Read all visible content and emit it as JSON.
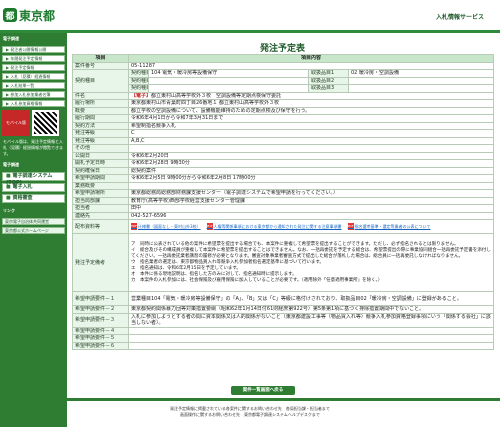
{
  "header": {
    "logo_text": "東京都",
    "logo_mark": "都",
    "service_name": "入札情報サービス"
  },
  "sidebar": {
    "section1": "電子調達",
    "nav": [
      "発注者公開情報公開",
      "年間発注予定情報",
      "発注予定情報",
      "入札（見積）経過情報",
      "入札結果一覧",
      "参加入札参加業者名簿",
      "入札参加資格情報"
    ],
    "mobile_label": "モバイル版",
    "mobile_note": "モバイル版は、発注予定情報と入札（見積）経過情報が閲覧できます。",
    "section2": "電子調達",
    "big": [
      "電子調達システム(TOP)",
      "電子入札",
      "資格審査"
    ],
    "section3": "リンク",
    "links": [
      "東京電子自治体共同運営",
      "東京都公式ホームページ"
    ]
  },
  "page": {
    "title": "発注予定表",
    "back_button": "案件一覧画面へ戻る"
  },
  "table": {
    "head_item": "項目",
    "head_content": "項目内容",
    "rows": [
      {
        "k": "案件番号",
        "v": "05-11287"
      },
      {
        "k": "契約種目1",
        "v": "104 電気・暖冷房等設備保守"
      },
      {
        "k": "取扱品目1",
        "v": "02 暖冷房・空調設備"
      },
      {
        "k": "件名",
        "tag": "【電子】",
        "v": "都立東村山高等学校外３校　空調設備等定期点検保守委託"
      },
      {
        "k": "履行場所",
        "v": "東京都東村山市青葉町四丁目26番地１ 都立東村山高等学校外３校"
      },
      {
        "k": "概要",
        "v": "都立学校の空調設備について、設備機能維持のための定期点検及び保守を行う。"
      },
      {
        "k": "履行期間",
        "v": "令和6年4月1日から令和7年3月31日まで"
      },
      {
        "k": "契約方法",
        "v": "希望制指名競争入札"
      },
      {
        "k": "発注等級",
        "v": "C"
      },
      {
        "k": "発注等級",
        "v": "A,B,C"
      },
      {
        "k": "その他",
        "v": ""
      },
      {
        "k": "公開日",
        "v": "令和6年2月20日"
      },
      {
        "k": "開札予定日時",
        "v": "令和6年2月28日 9時30分"
      },
      {
        "k": "契約確保日",
        "v": "総契約案件"
      },
      {
        "k": "希望申請期間",
        "v": "令和6年2月5日 9時00分から令和6年2月8日 17時00分"
      },
      {
        "k": "業務概要",
        "v": ""
      },
      {
        "k": "希望申請場所",
        "v": "東京都総務局総務部財務課支援センター（電子調達システムで希望申請を行ってください。）"
      },
      {
        "k": "担当局部課",
        "v": "教育庁(高等学校)西部学校経営支援センター管理課"
      },
      {
        "k": "担当者",
        "v": "田中"
      },
      {
        "k": "連絡先",
        "v": "042-527-6596"
      }
    ],
    "labels": {
      "kind": "契約種目",
      "item": "取扱品目",
      "docs": "配布資料等",
      "notes_head": "発注予定備考",
      "req": "希望申請要件"
    },
    "docs": [
      "仕様書（図面なし・東村山外3校）",
      "人権等関係事項における東京都から通知された発注に関する注意事項書",
      "指名選考基準・選定等業者の公表について"
    ],
    "notes": "ア　同時に公表されている他の案件に希望票を提出する場合でも、本案件に重複して希望票を提出することができます。ただし、必ず指名されるとは限りません。\nイ　総合及びその構成員が重複して本案件に希望票を提出することはできません。なお、一括再委託を予定する総合は、希望票提出の際に事業協同組合一括再委託予定書を添付してください。一括再委託業者講習の履修が必要となります。審査対象事業者審査方式で提出した総合が落札した場合は、総合員に一括再委託しなければなりません。\nウ　指名業者の選定は、東京都物品買入れ等競争入札参加者指名選定基準に基づいて行います。\nエ　指名通知は、令和6年2月15日を予定しています。\nオ　本件に係る現地説明は、指名した方のみに対して、指名通知時に提示します。\nカ　本案件の入札参加には、社会保険及び雇用保険に加入していることが必要です。（適用除外「任意適用事業所」を除く。）",
    "req1": "営業種目104「電気・暖冷房等設備保守」の「A」、「B」又は「C」等級に格付けされており、取扱品目02「暖冷房・空調設備」に登録があること。",
    "req2": "東京都契約関係暴力団等対策措置要綱（昭和62年1月14日付61財経庶第922号）第5条第1項に基づく排除措置期間中でないこと。",
    "req3": "入札に参加しようとする者の間に資本関係又は人的関係がないこと（東京都建設工事等（物品買入れ等）競争入札参加資格登録事項にいう「関係する会社」に該当しない者）。",
    "req_more": [
      "希望申請要件－４",
      "希望申請要件－５",
      "希望申請要件－６"
    ]
  },
  "footer": {
    "line1": "発注予定情報に掲載されている各案件に関するお問い合わせ先　各局担当課・担当者まで",
    "line2": "画面操作に関するお問い合わせ先　東京都電子調達システムヘルプデスクまで"
  }
}
